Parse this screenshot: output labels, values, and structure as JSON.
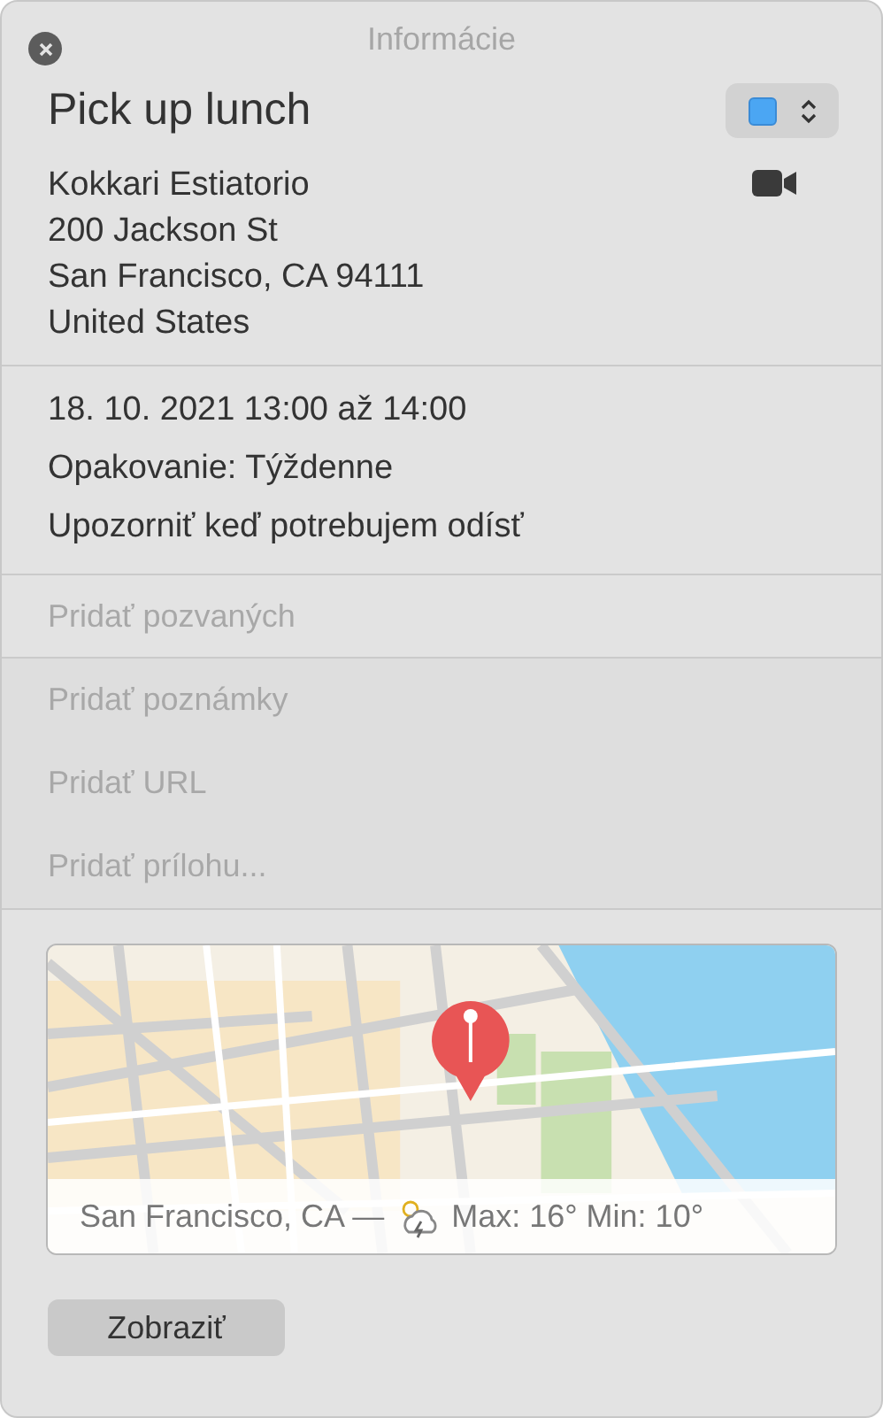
{
  "window": {
    "title": "Informácie"
  },
  "event": {
    "title": "Pick up lunch",
    "color": "#4ba6f3"
  },
  "location_lines": [
    "Kokkari Estiatorio",
    "200 Jackson St",
    "San Francisco, CA  94111",
    "United States"
  ],
  "details": [
    "18. 10. 2021  13:00 až 14:00",
    "Opakovanie: Týždenne",
    "Upozorniť keď potrebujem odísť"
  ],
  "invitees": {
    "placeholder": "Pridať pozvaných"
  },
  "extras": [
    {
      "placeholder": "Pridať poznámky"
    },
    {
      "placeholder": "Pridať URL"
    },
    {
      "placeholder": "Pridať prílohu..."
    }
  ],
  "map": {
    "kind": "picture",
    "weather": {
      "place": "San Francisco, CA —",
      "temps": "Max: 16° Min: 10°"
    }
  },
  "buttons": [
    "Zobraziť"
  ]
}
